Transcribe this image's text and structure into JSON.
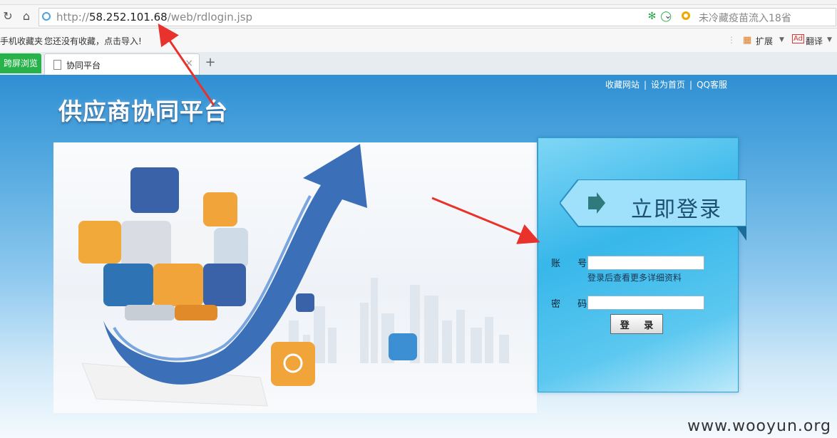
{
  "browser": {
    "address": {
      "scheme": "http://",
      "host": "58.252.101.68",
      "path": "/web/rdlogin.jsp"
    },
    "search_text": "未冷藏疫苗流入18省",
    "favorites": {
      "mobile_favorites": "手机收藏夹",
      "empty_hint": "您还没有收藏，点击导入!",
      "extensions_label": "扩展",
      "translate_label": "翻译"
    },
    "green_button_label": "跨屏浏览",
    "tab_label": "协同平台",
    "new_tab_glyph": "+"
  },
  "page": {
    "links": [
      "收藏网站",
      "设为首页",
      "QQ客服"
    ],
    "link_separator": "|",
    "site_title": "供应商协同平台",
    "login": {
      "heading": "立即登录",
      "account_label": "账 号",
      "account_value": "",
      "account_hint": "登录后查看更多详细资料",
      "password_label": "密 码",
      "password_value": "",
      "submit_label": "登 录"
    }
  },
  "watermark": "www.wooyun.org",
  "colors": {
    "page_top": "#2f8fd3",
    "panel": "#37b7ea",
    "annotation_arrow": "#e8322b",
    "green_button": "#27b34a"
  }
}
